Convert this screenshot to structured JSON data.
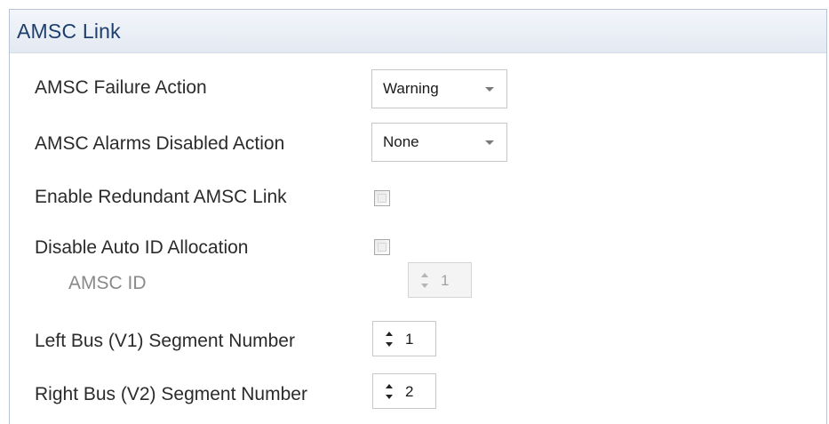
{
  "panel": {
    "title": "AMSC Link"
  },
  "rows": {
    "failure_action": {
      "label": "AMSC Failure Action",
      "value": "Warning"
    },
    "alarms_disabled_action": {
      "label": "AMSC Alarms Disabled Action",
      "value": "None"
    },
    "enable_redundant": {
      "label": "Enable Redundant AMSC Link",
      "checked": false
    },
    "disable_auto_id": {
      "label": "Disable Auto ID Allocation",
      "checked": false
    },
    "amsc_id": {
      "label": "AMSC ID",
      "value": "1",
      "disabled": true
    },
    "left_bus": {
      "label": "Left Bus (V1) Segment Number",
      "value": "1"
    },
    "right_bus": {
      "label": "Right Bus (V2) Segment Number",
      "value": "2"
    }
  },
  "icons": {
    "dropdown": "chevron-down-icon",
    "spin_up": "spin-up-icon",
    "spin_down": "spin-down-icon"
  },
  "colors": {
    "header_text": "#1e3f6e",
    "header_bg": "#e8edf5",
    "label_text": "#2b2b2b",
    "disabled_text": "#8a8a8a"
  }
}
